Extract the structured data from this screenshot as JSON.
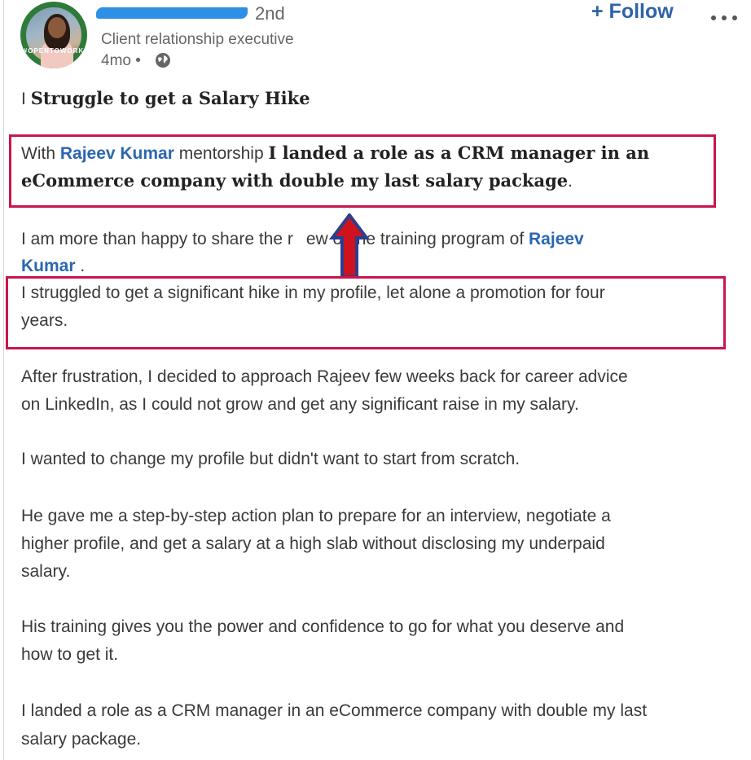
{
  "post": {
    "author": {
      "degree": "2nd",
      "headline": "Client relationship executive",
      "age": "4mo",
      "avatar_badge": "#OPENTOWORK"
    },
    "follow_label": "+ Follow",
    "heading": "Struggle to get a Salary Hike",
    "heading_prefix": "I",
    "para1": {
      "prefix": "With ",
      "mention": "Rajeev Kumar",
      "middle": " mentorship ",
      "bold_line1": "I landed a role as a CRM manager in an",
      "bold_line2": "eCommerce company with double my last salary package",
      "suffix": "."
    },
    "para2": {
      "line1_text": "I am more than happy to share the r",
      "line1_text_after": "ew of the training program of ",
      "mention_line1": "Rajeev",
      "mention_line2": "Kumar",
      "line2_suffix": " ."
    },
    "para3": {
      "line1": "I struggled to get a significant hike in my profile, let alone a promotion for four",
      "line2": "years."
    },
    "para4": {
      "line1": "After frustration, I decided to approach Rajeev few weeks back for career advice",
      "line2": "on LinkedIn, as I could not grow and get any significant raise in my salary."
    },
    "para5": {
      "line1": "I wanted to change my profile but didn't want to start from scratch."
    },
    "para6": {
      "line1": "He gave me a step-by-step action plan to prepare for an interview, negotiate a",
      "line2": "higher profile, and get a salary at a high slab without disclosing my underpaid",
      "line3": "salary."
    },
    "para7": {
      "line1": "His training gives you the power and confidence to go for what you deserve and",
      "line2": "how to get it."
    },
    "para8": {
      "line1": "I landed a role as a CRM manager in an eCommerce company with double my last",
      "line2": "salary package."
    }
  },
  "colors": {
    "highlight": "#c8164c",
    "arrow_fill": "#d0121c",
    "arrow_outline": "#2a3f8f",
    "mention": "#2a67b0",
    "redaction": "#2d8fe6"
  }
}
